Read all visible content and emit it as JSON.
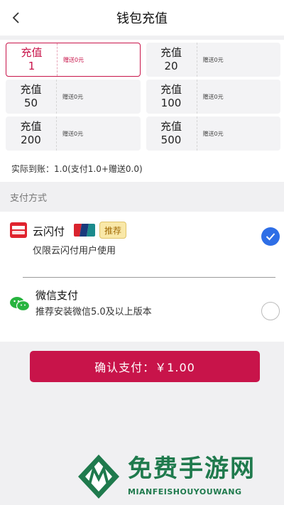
{
  "header": {
    "title": "钱包充值",
    "back_icon": "chevron-left-icon"
  },
  "amounts": [
    {
      "label": "充值",
      "value": "1",
      "bonus": "赠送0元",
      "selected": true
    },
    {
      "label": "充值",
      "value": "20",
      "bonus": "赠送0元",
      "selected": false
    },
    {
      "label": "充值",
      "value": "50",
      "bonus": "赠送0元",
      "selected": false
    },
    {
      "label": "充值",
      "value": "100",
      "bonus": "赠送0元",
      "selected": false
    },
    {
      "label": "充值",
      "value": "200",
      "bonus": "赠送0元",
      "selected": false
    },
    {
      "label": "充值",
      "value": "500",
      "bonus": "赠送0元",
      "selected": false
    }
  ],
  "actual": "实际到账：1.0(支付1.0+赠送0.0)",
  "payment": {
    "section_label": "支付方式",
    "methods": [
      {
        "name": "云闪付",
        "tag": "推荐",
        "desc": "仅限云闪付用户使用",
        "checked": true,
        "icon": "unionpay-icon"
      },
      {
        "name": "微信支付",
        "desc": "推荐安装微信5.0及以上版本",
        "checked": false,
        "icon": "wechat-icon"
      }
    ]
  },
  "confirm_label": "确认支付：￥1.00",
  "watermark": {
    "title": "免费手游网",
    "subtitle": "MIANFEISHOUYOUWANG"
  },
  "colors": {
    "accent": "#c8144a",
    "radio": "#2e6ee6",
    "wechat": "#27b43f",
    "watermark": "#1f7a4d"
  }
}
